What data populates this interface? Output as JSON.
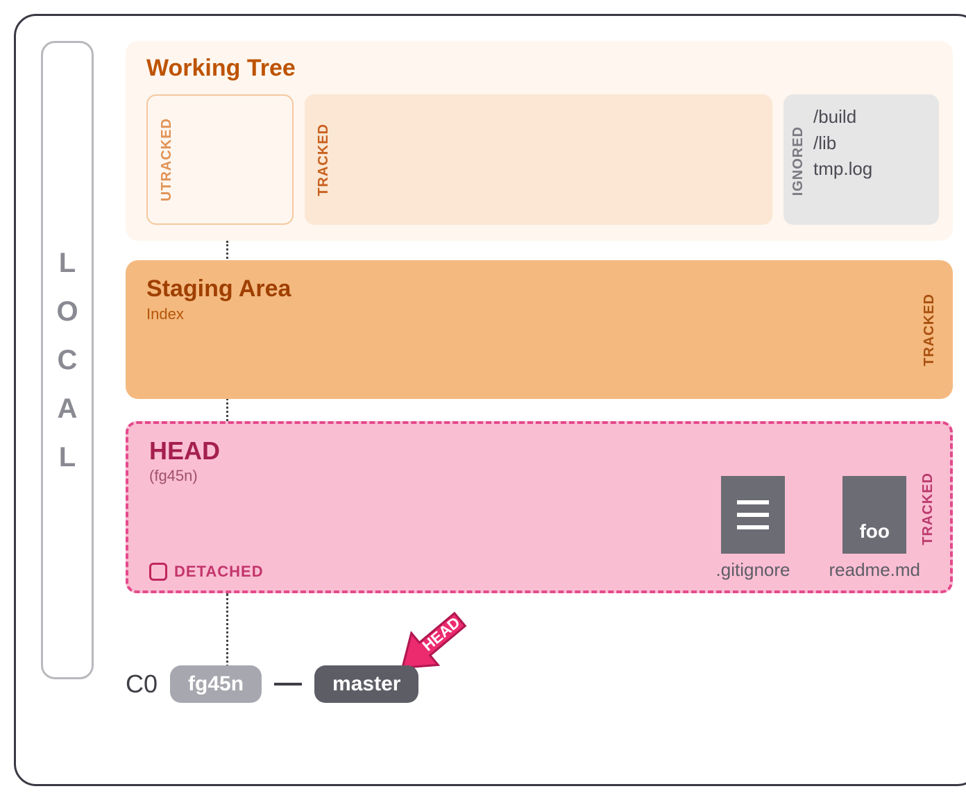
{
  "local_label": {
    "L": "L",
    "O": "O",
    "C": "C",
    "A": "A",
    "L2": "L"
  },
  "working_tree": {
    "title": "Working Tree",
    "utracked_label": "UTRACKED",
    "tracked_label": "TRACKED",
    "ignored_label": "IGNORED",
    "ignored_entries": {
      "e0": "/build",
      "e1": "/lib",
      "e2": "tmp.log"
    }
  },
  "staging": {
    "title": "Staging Area",
    "subtitle": "Index",
    "tracked_label": "TRACKED"
  },
  "head": {
    "title": "HEAD",
    "hash": "(fg45n)",
    "detached_label": "DETACHED",
    "tracked_label": "TRACKED",
    "files": {
      "gitignore": ".gitignore",
      "readme_icon_text": "foo",
      "readme": "readme.md"
    }
  },
  "commit": {
    "label": "C0",
    "hash": "fg45n",
    "branch": "master"
  },
  "head_pointer_label": "HEAD"
}
